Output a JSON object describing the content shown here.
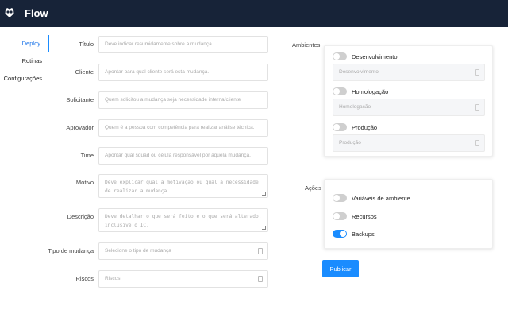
{
  "app": {
    "title": "Flow"
  },
  "sidebar": {
    "items": [
      {
        "label": "Deploy",
        "active": true
      },
      {
        "label": "Rotinas",
        "active": false
      },
      {
        "label": "Configurações",
        "active": false
      }
    ]
  },
  "form": {
    "fields": [
      {
        "label": "Título",
        "placeholder": "Deve indicar resumidamente sobre a mudança."
      },
      {
        "label": "Cliente",
        "placeholder": "Apontar para qual cliente será esta mudança."
      },
      {
        "label": "Solicitante",
        "placeholder": "Quem solicitou a mudança seja necessidade interna/cliente"
      },
      {
        "label": "Aprovador",
        "placeholder": "Quem é a pessoa com competência para realizar análise técnica."
      },
      {
        "label": "Time",
        "placeholder": "Apontar qual squad ou célula responsável por aquela mudança."
      },
      {
        "label": "Motivo",
        "placeholder": "Deve explicar qual a motivação ou qual a necessidade de realizar a mudança."
      },
      {
        "label": "Descrição",
        "placeholder": "Deve detalhar o que será feito e o que será alterado, inclusive o IC."
      },
      {
        "label": "Tipo de mudança",
        "placeholder": "Selecione o tipo de mudança"
      },
      {
        "label": "Riscos",
        "placeholder": "Riscos"
      }
    ]
  },
  "ambientes": {
    "label": "Ambientes",
    "items": [
      {
        "label": "Desenvolvimento",
        "enabled": false,
        "select_placeholder": "Desenvolvimento"
      },
      {
        "label": "Homologação",
        "enabled": false,
        "select_placeholder": "Homologação"
      },
      {
        "label": "Produção",
        "enabled": false,
        "select_placeholder": "Produção"
      }
    ]
  },
  "acoes": {
    "label": "Ações",
    "items": [
      {
        "label": "Variáveis de ambiente",
        "enabled": false
      },
      {
        "label": "Recursos",
        "enabled": false
      },
      {
        "label": "Backups",
        "enabled": true
      }
    ]
  },
  "actions": {
    "publish_label": "Publicar"
  },
  "colors": {
    "topbar": "#172338",
    "accent": "#1a8cff"
  },
  "icons": {
    "logo": "owl-logo-icon"
  }
}
